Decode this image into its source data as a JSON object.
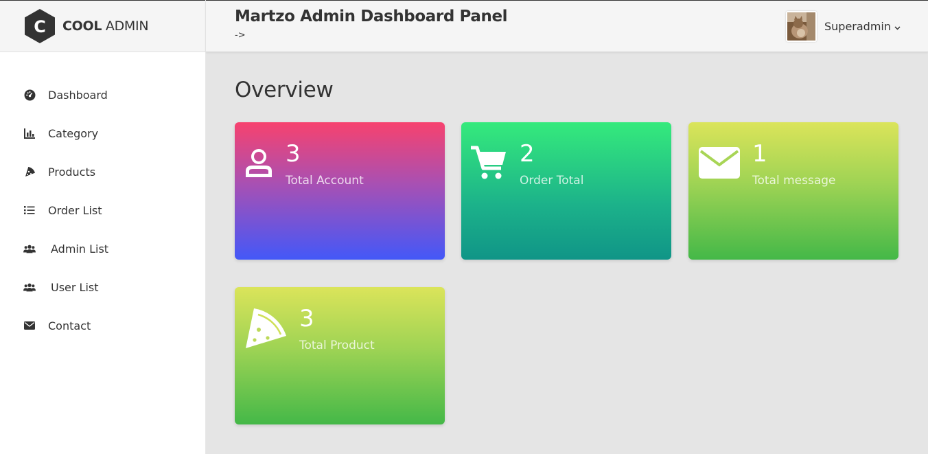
{
  "brand": {
    "bold": "COOL",
    "rest": " ADMIN",
    "logo_letter": "C"
  },
  "header": {
    "title": "Martzo Admin Dashboard Panel",
    "subtext": "->",
    "user_name": "Superadmin"
  },
  "sidebar": {
    "items": [
      {
        "label": "Dashboard",
        "icon": "dashboard-gauge-icon"
      },
      {
        "label": "Category",
        "icon": "chart-bar-icon"
      },
      {
        "label": "Products",
        "icon": "pizza-slice-icon"
      },
      {
        "label": "Order List",
        "icon": "list-icon"
      },
      {
        "label": "Admin List",
        "icon": "users-icon"
      },
      {
        "label": "User List",
        "icon": "users-icon"
      },
      {
        "label": "Contact",
        "icon": "envelope-icon"
      }
    ]
  },
  "main": {
    "title": "Overview",
    "cards": [
      {
        "value": "3",
        "label": "Total Account",
        "icon": "user-icon"
      },
      {
        "value": "2",
        "label": "Order Total",
        "icon": "shopping-cart-icon"
      },
      {
        "value": "1",
        "label": "Total message",
        "icon": "envelope-icon"
      },
      {
        "value": "3",
        "label": "Total Product",
        "icon": "pizza-slice-icon"
      }
    ]
  },
  "colors": {
    "card_account": [
      "#f7426e",
      "#4358f8"
    ],
    "card_order": [
      "#35ea7c",
      "#109587"
    ],
    "card_green": [
      "#dbe45a",
      "#44b848"
    ]
  }
}
